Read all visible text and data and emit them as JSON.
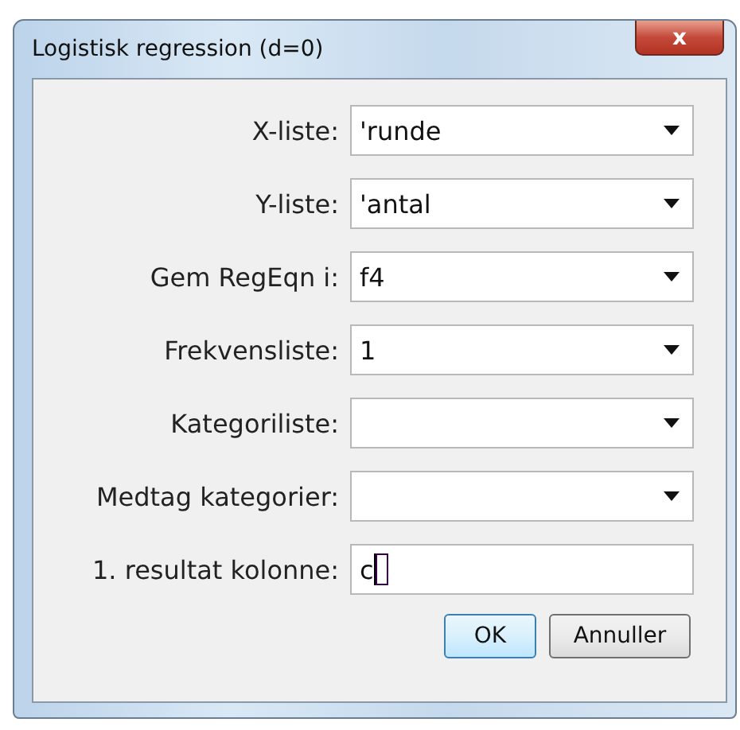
{
  "window": {
    "title": "Logistisk regression (d=0)",
    "close_label": "x"
  },
  "fields": [
    {
      "label": "X-liste:",
      "kind": "dropdown",
      "value": "'runde"
    },
    {
      "label": "Y-liste:",
      "kind": "dropdown",
      "value": "'antal"
    },
    {
      "label": "Gem RegEqn i:",
      "kind": "dropdown",
      "value": "f4"
    },
    {
      "label": "Frekvensliste:",
      "kind": "dropdown",
      "value": "1"
    },
    {
      "label": "Kategoriliste:",
      "kind": "dropdown"
    },
    {
      "label": "Medtag kategorier:",
      "kind": "dropdown"
    },
    {
      "label": "1. resultat kolonne:",
      "kind": "text",
      "value": "c"
    }
  ],
  "buttons": [
    {
      "label": "OK",
      "default": true
    },
    {
      "label": "Annuller",
      "default": false
    }
  ]
}
